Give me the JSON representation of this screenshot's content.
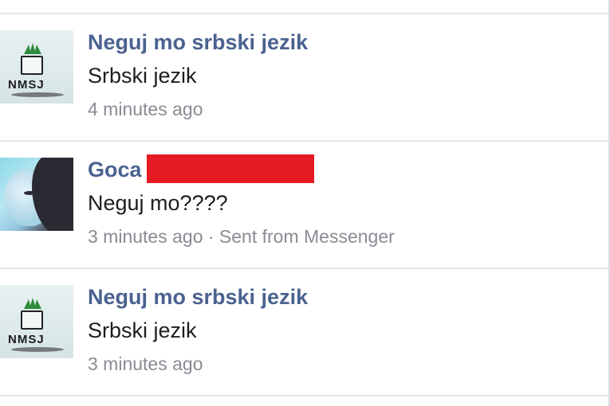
{
  "messages": [
    {
      "sender": "Neguj mo srbski jezik",
      "text": "Srbski jezik",
      "time": "4 minutes ago",
      "avatar_text": "NMSJ",
      "avatar_icon": "nmsj-logo-icon"
    },
    {
      "sender": "Goca",
      "text": "Neguj mo????",
      "time": "3 minutes ago · Sent from Messenger",
      "avatar_icon": "profile-photo",
      "redaction_color": "#e41b22"
    },
    {
      "sender": "Neguj mo srbski jezik",
      "text": "Srbski jezik",
      "time": "3 minutes ago",
      "avatar_text": "NMSJ",
      "avatar_icon": "nmsj-logo-icon"
    }
  ],
  "colors": {
    "sender_name": "#4b6290",
    "message_text": "#1c1e21",
    "meta_text": "#888c92",
    "divider": "#e4e6eb"
  }
}
